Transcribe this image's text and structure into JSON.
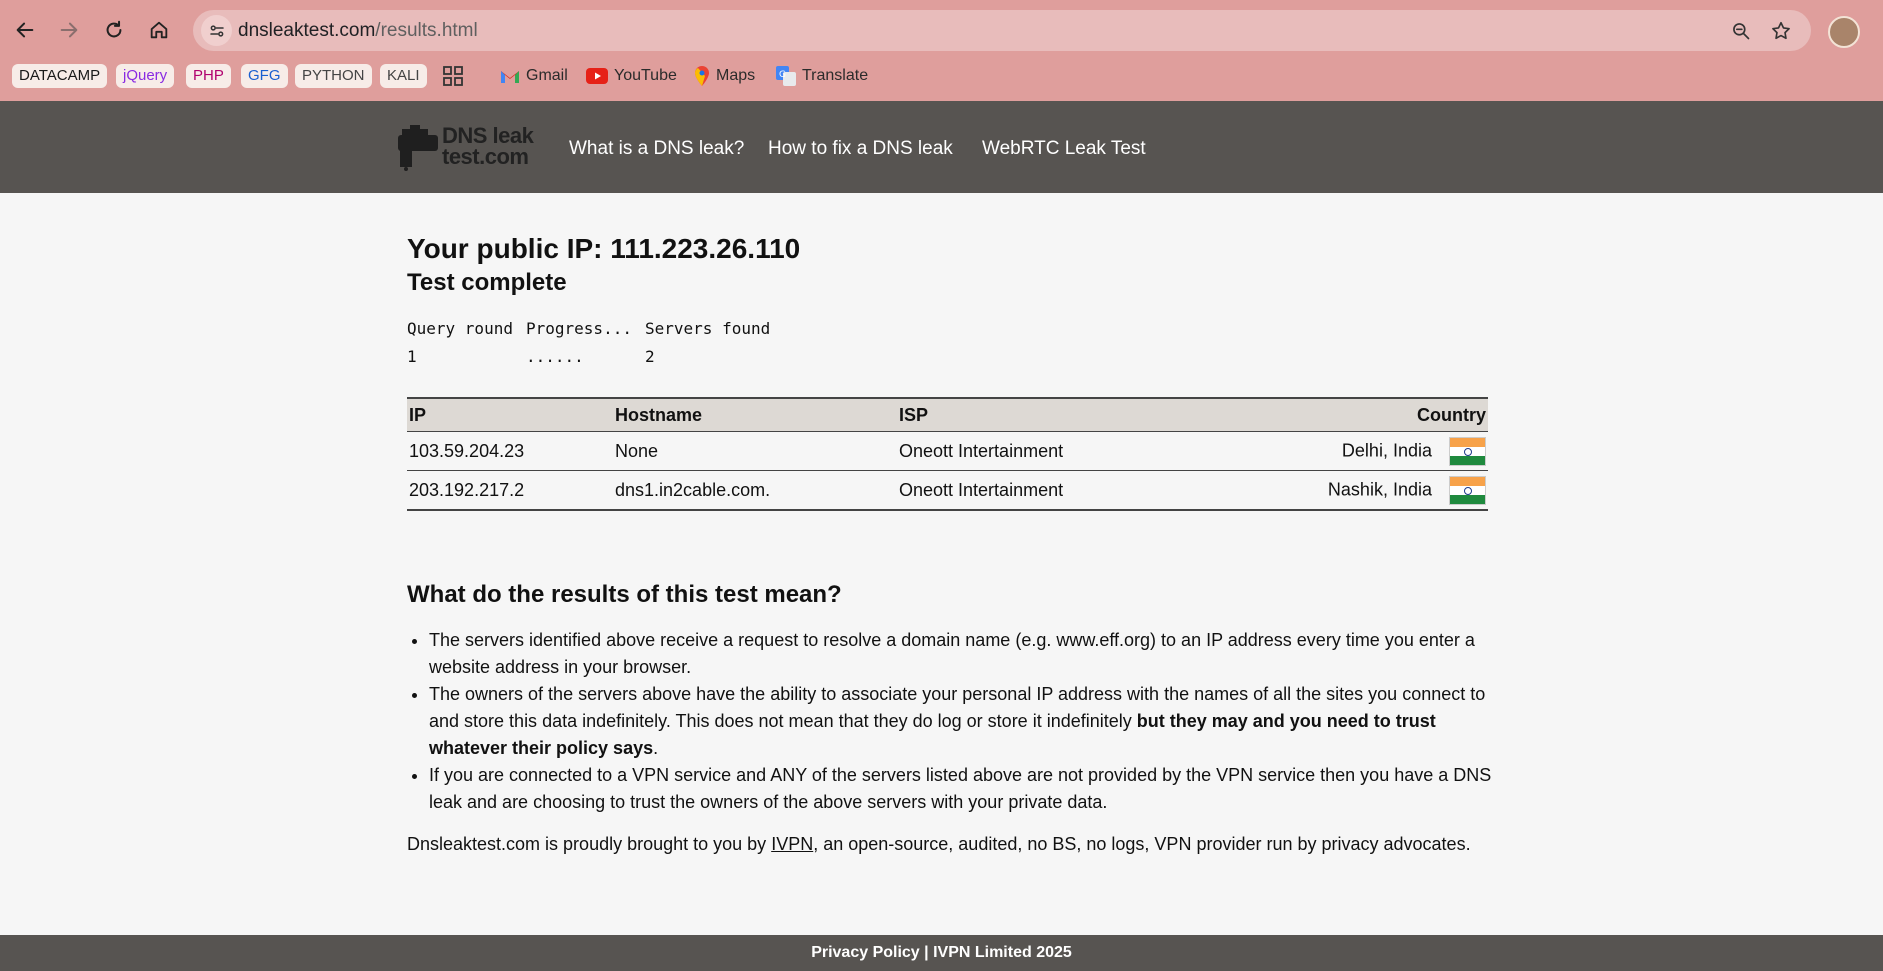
{
  "browser": {
    "url_domain": "dnsleaktest.com",
    "url_path": "/results.html",
    "bookmarks": {
      "chips": [
        {
          "label": "DATACAMP",
          "color": "#1a1a1a"
        },
        {
          "label": "jQuery",
          "color": "#8a2be2"
        },
        {
          "label": "PHP",
          "color": "#b0006e"
        },
        {
          "label": "GFG",
          "color": "#1a5fd0"
        },
        {
          "label": "PYTHON",
          "color": "#444444"
        },
        {
          "label": "KALI",
          "color": "#444444"
        }
      ],
      "links": [
        "Gmail",
        "YouTube",
        "Maps",
        "Translate"
      ]
    }
  },
  "site": {
    "logo_line1": "DNS leak",
    "logo_line2": "test.com",
    "nav": [
      "What is a DNS leak?",
      "How to fix a DNS leak",
      "WebRTC Leak Test"
    ]
  },
  "result": {
    "public_ip_text": "Your public IP: 111.223.26.110",
    "status": "Test complete",
    "query_headers": [
      "Query round",
      "Progress...",
      "Servers found"
    ],
    "query_row": [
      "1",
      "......",
      "2"
    ]
  },
  "table": {
    "headers": [
      "IP",
      "Hostname",
      "ISP",
      "Country"
    ],
    "rows": [
      {
        "ip": "103.59.204.23",
        "hostname": "None",
        "isp": "Oneott Intertainment",
        "country": "Delhi, India"
      },
      {
        "ip": "203.192.217.2",
        "hostname": "dns1.in2cable.com.",
        "isp": "Oneott Intertainment",
        "country": "Nashik, India"
      }
    ]
  },
  "explain": {
    "heading": "What do the results of this test mean?",
    "item1": "The servers identified above receive a request to resolve a domain name (e.g. www.eff.org) to an IP address every time you enter a website address in your browser.",
    "item2_a": "The owners of the servers above have the ability to associate your personal IP address with the names of all the sites you connect to and store this data indefinitely. This does not mean that they do log or store it indefinitely ",
    "item2_b": "but they may and you need to trust whatever their policy says",
    "item2_c": ".",
    "item3": "If you are connected to a VPN service and ANY of the servers listed above are not provided by the VPN service then you have a DNS leak and are choosing to trust the owners of the above servers with your private data."
  },
  "credit": {
    "before": "Dnsleaktest.com is proudly brought to you by ",
    "link": "IVPN",
    "after": ", an open-source, audited, no BS, no logs, VPN provider run by privacy advocates."
  },
  "footer": "Privacy Policy | IVPN Limited 2025"
}
